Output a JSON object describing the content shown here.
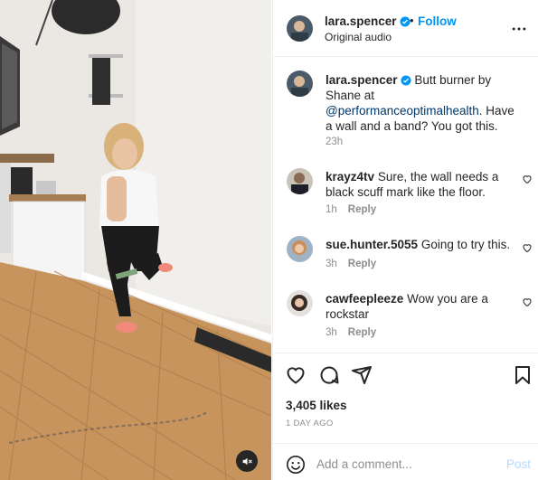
{
  "post": {
    "username": "lara.spencer",
    "follow_label": "Follow",
    "audio_label": "Original audio",
    "more_icon": "more-horizontal-icon",
    "verified_color": "#0095f6"
  },
  "caption": {
    "username": "lara.spencer",
    "text_before": "Butt burner by Shane at ",
    "mention": "@performanceoptimalhealth",
    "text_after": ". Have a wall and a band? You got this.",
    "time": "23h"
  },
  "comments": [
    {
      "username": "krayz4tv",
      "text": "Sure, the wall needs a black scuff mark like the floor.",
      "time": "1h",
      "reply_label": "Reply"
    },
    {
      "username": "sue.hunter.5055",
      "text": "Going to try this.",
      "time": "3h",
      "reply_label": "Reply"
    },
    {
      "username": "cawfeepleeze",
      "text": "Wow you are a rockstar",
      "time": "3h",
      "reply_label": "Reply"
    }
  ],
  "actions": {
    "like_icon": "heart-icon",
    "comment_icon": "comment-icon",
    "share_icon": "send-icon",
    "save_icon": "bookmark-icon"
  },
  "likes": "3,405 likes",
  "date": "1 DAY AGO",
  "add_comment": {
    "placeholder": "Add a comment...",
    "post_label": "Post"
  },
  "colors": {
    "accent": "#0095f6",
    "mention": "#00376b",
    "muted": "#8e8e8e",
    "post_disabled": "#b3dbff"
  }
}
